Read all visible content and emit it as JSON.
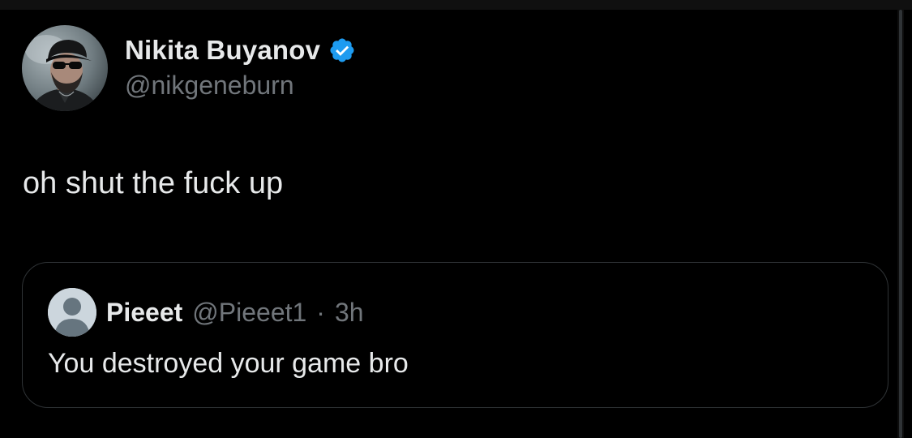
{
  "author": {
    "name": "Nikita Buyanov",
    "handle": "@nikgeneburn",
    "verified": true,
    "avatar_icon": "user-photo-avatar"
  },
  "tweet": {
    "text": "oh shut the fuck up"
  },
  "quoted_tweet": {
    "name": "Pieeet",
    "handle": "@Pieeet1",
    "separator": "·",
    "time": "3h",
    "text": "You destroyed your game bro",
    "avatar_icon": "default-user-avatar"
  },
  "colors": {
    "background": "#000000",
    "primary_text": "#e7e9ea",
    "secondary_text": "#71767b",
    "border": "#2f3336",
    "verified_blue": "#1d9bf0"
  }
}
